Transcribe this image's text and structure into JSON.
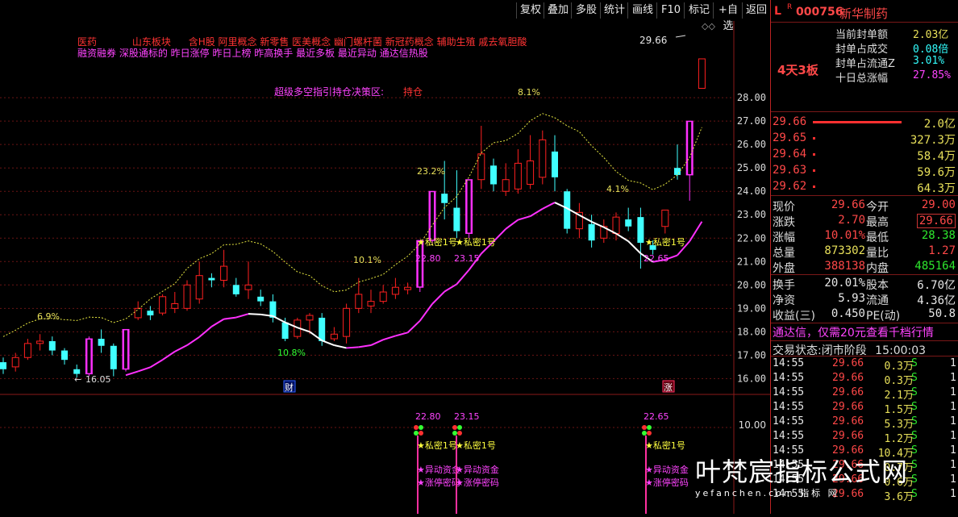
{
  "toolbar": {
    "buttons": [
      "复权",
      "叠加",
      "多股",
      "统计",
      "画线",
      "F10",
      "标记",
      "+自选",
      "返回"
    ]
  },
  "chart": {
    "concepts_line1": [
      {
        "text": "医药",
        "color": "#ff3333"
      },
      {
        "text": "山东板块",
        "color": "#ff3333"
      },
      {
        "text": "含H股 阿里概念 新零售 医美概念 幽门螺杆菌 新冠药概念 辅助生殖 戚去氧胆酸",
        "color": "#ff3333"
      }
    ],
    "concepts_line2": "融资融券 深股通标的 昨日涨停 昨日上榜 昨高换手 最近多板 最近异动 通达信热股",
    "decision_label": "超级多空指引持仓决策区:",
    "decision_value": "持仓",
    "price_ticks": [
      "28.00",
      "27.00",
      "26.00",
      "25.00",
      "24.00",
      "23.00",
      "22.00",
      "21.00",
      "20.00",
      "19.00",
      "18.00",
      "17.00",
      "16.00"
    ],
    "price_min": 15.6,
    "price_max": 29.9,
    "last_price_label": "29.66",
    "low_label": "16.05",
    "pct_labels": [
      "6.9%",
      "10.8%",
      "10.1%",
      "23.2%",
      "8.1%",
      "4.1%"
    ],
    "signal_prices": [
      "22.80",
      "23.15",
      "22.65"
    ],
    "signal_label": "★私密1号",
    "markers": [
      "财",
      "涨"
    ],
    "lower_tick": "10.00",
    "lower_signal_1": "★异动资金",
    "lower_signal_2": "★涨停密码",
    "candles": [
      {
        "o": 16.7,
        "c": 16.4,
        "h": 16.9,
        "l": 16.2
      },
      {
        "o": 16.5,
        "c": 16.9,
        "h": 17.1,
        "l": 16.3
      },
      {
        "o": 16.9,
        "c": 17.5,
        "h": 17.7,
        "l": 16.8
      },
      {
        "o": 17.5,
        "c": 17.6,
        "h": 17.9,
        "l": 17.2
      },
      {
        "o": 17.6,
        "c": 17.2,
        "h": 17.8,
        "l": 17.0
      },
      {
        "o": 17.2,
        "c": 16.8,
        "h": 17.3,
        "l": 16.6
      },
      {
        "o": 16.4,
        "c": 16.2,
        "h": 16.6,
        "l": 16.05
      },
      {
        "o": 16.2,
        "c": 17.7,
        "h": 17.8,
        "l": 16.1
      },
      {
        "o": 17.7,
        "c": 17.4,
        "h": 18.1,
        "l": 17.1
      },
      {
        "o": 17.4,
        "c": 16.4,
        "h": 17.5,
        "l": 16.1
      },
      {
        "o": 16.4,
        "c": 18.1,
        "h": 18.1,
        "l": 16.3
      },
      {
        "o": 18.6,
        "c": 19.0,
        "h": 19.3,
        "l": 18.5
      },
      {
        "o": 18.9,
        "c": 18.7,
        "h": 19.1,
        "l": 18.5
      },
      {
        "o": 18.8,
        "c": 19.5,
        "h": 19.6,
        "l": 18.7
      },
      {
        "o": 19.0,
        "c": 19.2,
        "h": 19.7,
        "l": 18.8
      },
      {
        "o": 19.0,
        "c": 20.0,
        "h": 20.2,
        "l": 18.9
      },
      {
        "o": 19.4,
        "c": 20.4,
        "h": 21.0,
        "l": 19.2
      },
      {
        "o": 20.3,
        "c": 20.2,
        "h": 20.5,
        "l": 19.9
      },
      {
        "o": 20.2,
        "c": 20.8,
        "h": 21.5,
        "l": 19.9
      },
      {
        "o": 20.0,
        "c": 19.6,
        "h": 20.3,
        "l": 19.5
      },
      {
        "o": 19.8,
        "c": 20.0,
        "h": 21.0,
        "l": 19.4
      },
      {
        "o": 19.5,
        "c": 19.3,
        "h": 19.8,
        "l": 19.1
      },
      {
        "o": 19.3,
        "c": 18.6,
        "h": 19.6,
        "l": 18.4
      },
      {
        "o": 18.4,
        "c": 17.7,
        "h": 18.6,
        "l": 17.6
      },
      {
        "o": 17.8,
        "c": 18.5,
        "h": 18.6,
        "l": 17.7
      },
      {
        "o": 18.5,
        "c": 18.7,
        "h": 18.8,
        "l": 17.9
      },
      {
        "o": 18.6,
        "c": 17.6,
        "h": 18.8,
        "l": 17.4
      },
      {
        "o": 17.7,
        "c": 17.9,
        "h": 18.2,
        "l": 17.6
      },
      {
        "o": 17.8,
        "c": 19.0,
        "h": 19.2,
        "l": 17.5
      },
      {
        "o": 19.0,
        "c": 19.6,
        "h": 20.3,
        "l": 18.8
      },
      {
        "o": 19.1,
        "c": 19.3,
        "h": 19.8,
        "l": 18.8
      },
      {
        "o": 19.3,
        "c": 19.7,
        "h": 20.0,
        "l": 19.2
      },
      {
        "o": 19.6,
        "c": 19.9,
        "h": 20.3,
        "l": 19.4
      },
      {
        "o": 19.8,
        "c": 19.9,
        "h": 20.1,
        "l": 19.6
      },
      {
        "o": 19.9,
        "c": 21.9,
        "h": 21.9,
        "l": 19.7
      },
      {
        "o": 21.9,
        "c": 24.0,
        "h": 24.0,
        "l": 21.7
      },
      {
        "o": 23.9,
        "c": 23.5,
        "h": 25.3,
        "l": 22.8
      },
      {
        "o": 23.3,
        "c": 22.3,
        "h": 24.9,
        "l": 22.0
      },
      {
        "o": 22.2,
        "c": 24.5,
        "h": 24.5,
        "l": 22.0
      },
      {
        "o": 24.5,
        "c": 25.6,
        "h": 26.8,
        "l": 24.1
      },
      {
        "o": 25.1,
        "c": 24.3,
        "h": 25.4,
        "l": 24.0
      },
      {
        "o": 24.0,
        "c": 24.5,
        "h": 25.2,
        "l": 23.8
      },
      {
        "o": 24.1,
        "c": 25.2,
        "h": 25.8,
        "l": 23.9
      },
      {
        "o": 24.3,
        "c": 25.3,
        "h": 26.4,
        "l": 24.1
      },
      {
        "o": 24.6,
        "c": 26.2,
        "h": 26.6,
        "l": 24.3
      },
      {
        "o": 25.7,
        "c": 24.6,
        "h": 26.4,
        "l": 24.0
      },
      {
        "o": 24.0,
        "c": 22.4,
        "h": 24.1,
        "l": 22.2
      },
      {
        "o": 22.4,
        "c": 23.1,
        "h": 23.5,
        "l": 22.0
      },
      {
        "o": 22.6,
        "c": 21.9,
        "h": 23.0,
        "l": 21.6
      },
      {
        "o": 22.0,
        "c": 22.5,
        "h": 22.8,
        "l": 21.8
      },
      {
        "o": 22.2,
        "c": 22.9,
        "h": 23.1,
        "l": 21.9
      },
      {
        "o": 22.8,
        "c": 22.5,
        "h": 23.3,
        "l": 22.3
      },
      {
        "o": 22.9,
        "c": 21.8,
        "h": 23.3,
        "l": 20.7
      },
      {
        "o": 21.7,
        "c": 21.5,
        "h": 21.9,
        "l": 21.3
      },
      {
        "o": 22.5,
        "c": 23.2,
        "h": 23.2,
        "l": 22.2
      },
      {
        "o": 25.0,
        "c": 24.7,
        "h": 26.0,
        "l": 24.5
      },
      {
        "o": 24.7,
        "c": 27.0,
        "h": 27.0,
        "l": 23.6
      },
      {
        "o": 28.4,
        "c": 29.66,
        "h": 29.66,
        "l": 28.4
      }
    ],
    "colors": {
      "up": "#ff2020",
      "down": "#40ffff",
      "limit_up": "#ff30ff",
      "ma_upper": "#e6e640",
      "ma_lower_white": "#ffffff",
      "ma_lower_mag": "#ff30ff",
      "ma_lower_green": "#20c020"
    }
  },
  "panel": {
    "code": "000756",
    "name": "新华制药",
    "board_status": "4天3板",
    "seal_rows": [
      {
        "label": "当前封单额",
        "value": "2.03亿"
      },
      {
        "label": "封单占成交",
        "value": "0.08倍"
      },
      {
        "label": "封单占流通Z",
        "value": "3.01%"
      },
      {
        "label": "十日总涨幅",
        "value": "27.85%"
      }
    ],
    "order_rows": [
      {
        "price": "29.66",
        "vol": "2.0亿"
      },
      {
        "price": "29.65",
        "vol": "327.3万"
      },
      {
        "price": "29.64",
        "vol": "58.4万"
      },
      {
        "price": "29.63",
        "vol": "59.6万"
      },
      {
        "price": "29.62",
        "vol": "64.3万"
      }
    ],
    "quote_rows": [
      {
        "l1": "现价",
        "v1": "29.66",
        "l2": "今开",
        "v2": "29.00"
      },
      {
        "l1": "涨跌",
        "v1": "2.70",
        "l2": "最高",
        "v2": "29.66"
      },
      {
        "l1": "涨幅",
        "v1": "10.01%",
        "l2": "最低",
        "v2": "28.38"
      },
      {
        "l1": "总量",
        "v1": "873302",
        "l2": "量比",
        "v2": "1.27"
      },
      {
        "l1": "外盘",
        "v1": "388138",
        "l2": "内盘",
        "v2": "485164"
      }
    ],
    "stat_rows": [
      {
        "l1": "换手",
        "v1": "20.01%",
        "l2": "股本",
        "v2": "6.70亿"
      },
      {
        "l1": "净资",
        "v1": "5.93",
        "l2": "流通",
        "v2": "4.36亿"
      },
      {
        "l1": "收益(三)",
        "v1": "0.450",
        "l2": "PE(动)",
        "v2": "50.8"
      }
    ],
    "ad_text": "通达信，仅需20元查看千档行情",
    "trade_status_label": "交易状态:",
    "trade_status_value": "闭市阶段",
    "trade_time": "15:00:03",
    "ticks": [
      {
        "time": "14:55",
        "price": "29.66",
        "vol": "0.3万",
        "side": "S",
        "n": "1"
      },
      {
        "time": "14:55",
        "price": "29.66",
        "vol": "0.3万",
        "side": "S",
        "n": "1"
      },
      {
        "time": "14:55",
        "price": "29.66",
        "vol": "2.1万",
        "side": "S",
        "n": "1"
      },
      {
        "time": "14:55",
        "price": "29.66",
        "vol": "1.5万",
        "side": "S",
        "n": "1"
      },
      {
        "time": "14:55",
        "price": "29.66",
        "vol": "5.3万",
        "side": "S",
        "n": "1"
      },
      {
        "time": "14:55",
        "price": "29.66",
        "vol": "1.2万",
        "side": "S",
        "n": "1"
      },
      {
        "time": "14:55",
        "price": "29.66",
        "vol": "10.4万",
        "side": "S",
        "n": "1"
      },
      {
        "time": "14:55",
        "price": "29.66",
        "vol": "0.7万",
        "side": "S",
        "n": "1"
      },
      {
        "time": "14:55",
        "price": "29.66",
        "vol": "0.6万",
        "side": "S",
        "n": "1"
      },
      {
        "time": "14:55",
        "price": "29.66",
        "vol": "3.6万",
        "side": "S",
        "n": "1"
      }
    ]
  },
  "watermark": {
    "text": "叶梵宸指标公式网",
    "url": "yefanchen.com 指标 网"
  }
}
